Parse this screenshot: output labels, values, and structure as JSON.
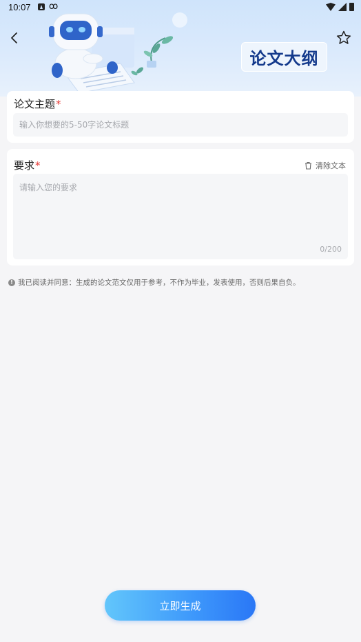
{
  "status_bar": {
    "time": "10:07"
  },
  "header": {
    "title": "论文大纲"
  },
  "topic": {
    "label": "论文主题",
    "required_mark": "*",
    "placeholder": "输入你想要的5-50字论文标题"
  },
  "requirements": {
    "label": "要求",
    "required_mark": "*",
    "clear_label": "清除文本",
    "placeholder": "请输入您的要求",
    "counter": "0/200"
  },
  "notice": "我已阅读并同意：生成的论文范文仅用于参考，不作为毕业，发表使用，否则后果自负。",
  "actions": {
    "generate_label": "立即生成"
  },
  "colors": {
    "primary": "#2a77f6",
    "title_text": "#143a8c",
    "required": "#e53935"
  }
}
